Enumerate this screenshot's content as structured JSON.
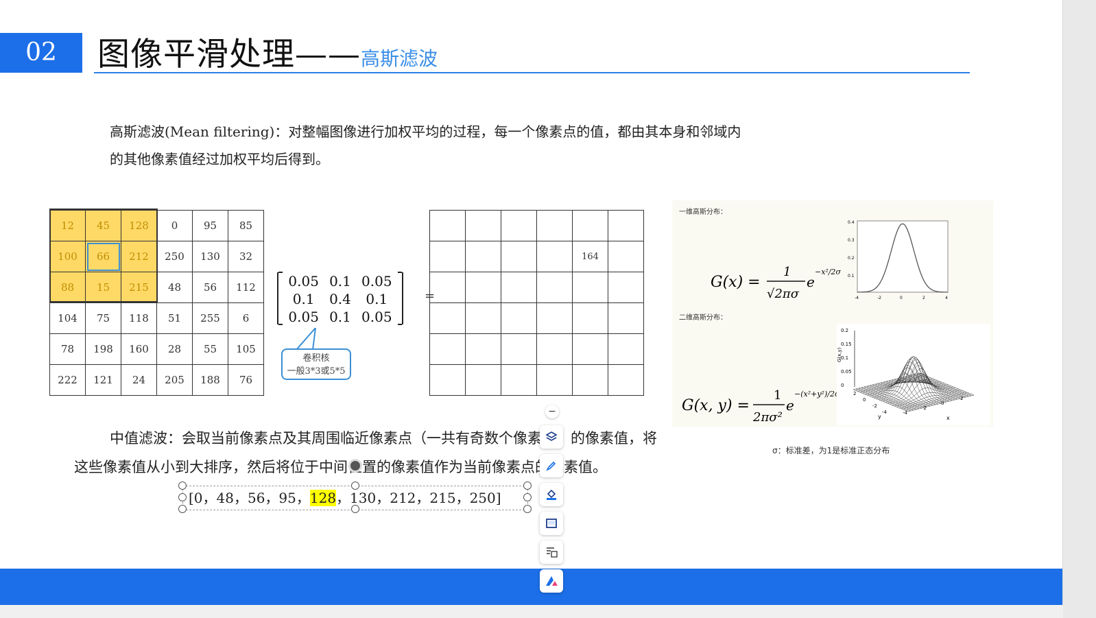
{
  "slide": {
    "number": "02",
    "title": "图像平滑处理——",
    "subtitle": "高斯滤波",
    "intro_line1_a": "高斯滤波(Mean filtering)",
    "intro_line1_b": "：对整幅图像进行加权平均的过程，每一个像素点的值，都由其本身和邻域内",
    "intro_line2": "的其他像素值经过加权平均后得到。"
  },
  "input_grid": [
    [
      "12",
      "45",
      "128",
      "0",
      "95",
      "85"
    ],
    [
      "100",
      "66",
      "212",
      "250",
      "130",
      "32"
    ],
    [
      "88",
      "15",
      "215",
      "48",
      "56",
      "112"
    ],
    [
      "104",
      "75",
      "118",
      "51",
      "255",
      "6"
    ],
    [
      "78",
      "198",
      "160",
      "28",
      "55",
      "105"
    ],
    [
      "222",
      "121",
      "24",
      "205",
      "188",
      "76"
    ]
  ],
  "kernel": [
    "0.05",
    "0.1",
    "0.05",
    "0.1",
    "0.4",
    "0.1",
    "0.05",
    "0.1",
    "0.05"
  ],
  "equals_sign": "=",
  "kernel_note": {
    "line1": "卷积核",
    "line2": "一般3*3或5*5"
  },
  "output_value": "164",
  "gauss": {
    "label_1d": "一维高斯分布：",
    "label_2d": "二维高斯分布：",
    "sigma_note": "σ：标准差，为1是标准正态分布",
    "plot1_yticks": [
      "0.4",
      "0.3",
      "0.2",
      "0.1"
    ],
    "plot1_xticks": [
      "-4",
      "-2",
      "0",
      "2",
      "4"
    ],
    "plot2_zticks": [
      "0.2",
      "0.15",
      "0.1",
      "0.05",
      "0"
    ],
    "plot2_ylabels": [
      "2",
      "0",
      "-2",
      "-4"
    ],
    "plot2_xlabels": [
      "-4",
      "-2",
      "0",
      "2"
    ],
    "axis_x": "x",
    "axis_y": "y"
  },
  "median": {
    "line1": "中值滤波：会取当前像素点及其周围临近像素点（一共有奇数个像素点）的像素值，将",
    "line2": "这些像素值从小到大排序，然后将位于中间位置的像素值作为当前像素点的像素值。",
    "sorted_before": "[0，48，56，95，",
    "sorted_mid": "128",
    "sorted_after": "，130，212，215，250]"
  },
  "toolbar": {
    "minimize": "−",
    "icons": [
      "layers-icon",
      "pen-icon",
      "fill-icon",
      "frame-icon",
      "comment-icon",
      "brand-icon"
    ]
  }
}
